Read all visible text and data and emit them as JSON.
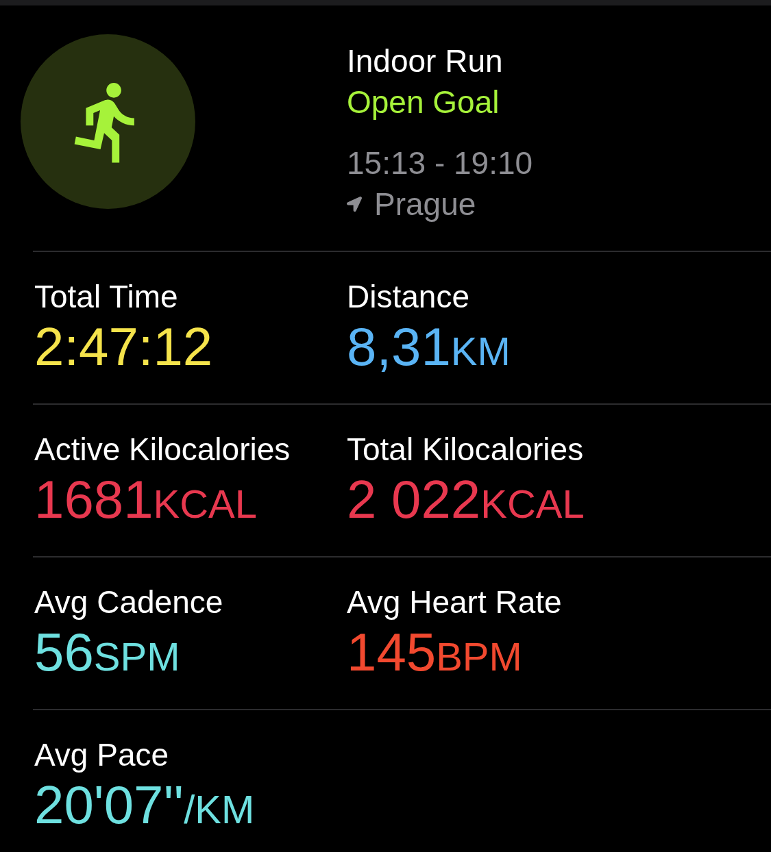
{
  "workout": {
    "title": "Indoor Run",
    "goal": "Open Goal",
    "time_range": "15:13 - 19:10",
    "location": "Prague"
  },
  "metrics": [
    {
      "label": "Total Time",
      "value": "2:47:12",
      "color": "#f5e34b"
    },
    {
      "label": "Distance",
      "value": "8,31",
      "unit": "KM",
      "color": "#5ab4f5"
    },
    {
      "label": "Active Kilocalories",
      "value": "1681",
      "unit": "KCAL",
      "color": "#e8384f"
    },
    {
      "label": "Total Kilocalories",
      "value": "2 022",
      "unit": "KCAL",
      "color": "#e8384f"
    },
    {
      "label": "Avg Cadence",
      "value": "56",
      "unit": "SPM",
      "color": "#6ee0e0"
    },
    {
      "label": "Avg Heart Rate",
      "value": "145",
      "unit": "BPM",
      "color": "#f2492f"
    },
    {
      "label": "Avg Pace",
      "value": "20'07''",
      "unit": "/KM",
      "color": "#6ee0e0"
    }
  ]
}
